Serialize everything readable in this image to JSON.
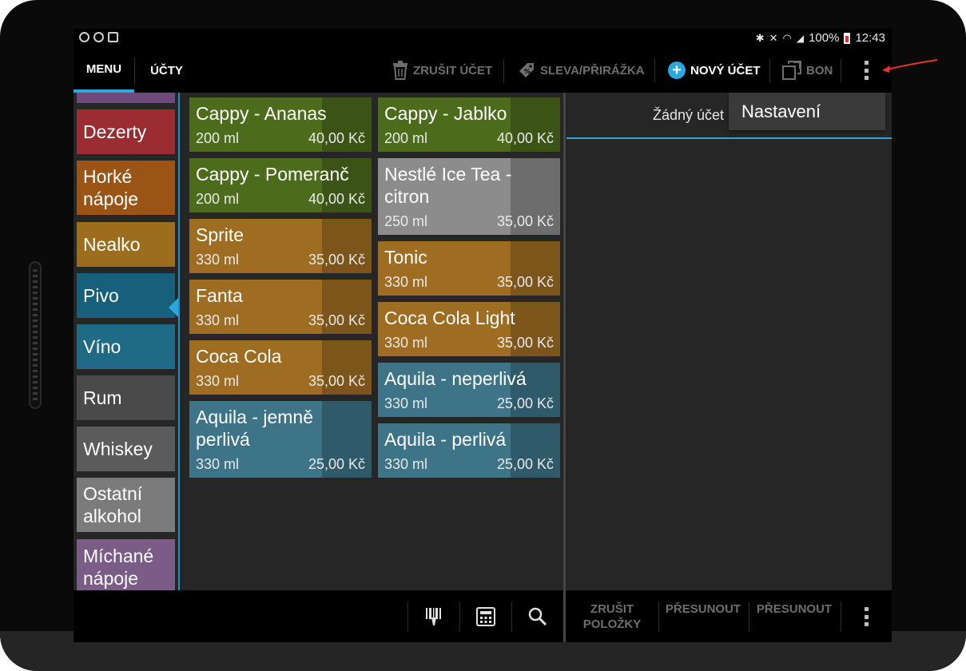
{
  "status_bar": {
    "battery": "100%",
    "time": "12:43"
  },
  "action_bar": {
    "tabs": [
      {
        "label": "MENU",
        "active": true
      },
      {
        "label": "ÚČTY",
        "active": false
      }
    ],
    "actions": [
      {
        "label": "ZRUŠIT ÚČET",
        "icon": "trash-icon",
        "enabled": false
      },
      {
        "label": "SLEVA/PŘIRÁŽKA",
        "icon": "tag-icon",
        "enabled": false
      },
      {
        "label": "NOVÝ ÚČET",
        "icon": "plus-circle-icon",
        "enabled": true
      },
      {
        "label": "BON",
        "icon": "bon-icon",
        "enabled": false
      }
    ],
    "overflow_icon": "overflow-menu-icon"
  },
  "categories": [
    {
      "label": "Dezerty",
      "color": "#9b2c31"
    },
    {
      "label": "Horké nápoje",
      "color": "#9a5516"
    },
    {
      "label": "Nealko",
      "color": "#9c6d1d",
      "selected": true
    },
    {
      "label": "Pivo",
      "color": "#17607c"
    },
    {
      "label": "Víno",
      "color": "#1f6b86"
    },
    {
      "label": "Rum",
      "color": "#4a4a4a"
    },
    {
      "label": "Whiskey",
      "color": "#5b5b5b"
    },
    {
      "label": "Ostatní alkohol",
      "color": "#7b7b7b"
    },
    {
      "label": "Míchané nápoje",
      "color": "#7a5c87"
    }
  ],
  "products": [
    {
      "name": "Cappy - Ananas",
      "volume": "200 ml",
      "price": "40,00 Kč",
      "color": "#4c6c1c"
    },
    {
      "name": "Cappy - Jablko",
      "volume": "200 ml",
      "price": "40,00 Kč",
      "color": "#4c6c1c"
    },
    {
      "name": "Cappy - Pomeranč",
      "volume": "200 ml",
      "price": "40,00 Kč",
      "color": "#4c6c1c"
    },
    {
      "name": "Nestlé Ice Tea - citron",
      "volume": "250 ml",
      "price": "35,00 Kč",
      "color": "#8c8c8c"
    },
    {
      "name": "Sprite",
      "volume": "330 ml",
      "price": "35,00 Kč",
      "color": "#9f6d22"
    },
    {
      "name": "Tonic",
      "volume": "330 ml",
      "price": "35,00 Kč",
      "color": "#9f6d22"
    },
    {
      "name": "Fanta",
      "volume": "330 ml",
      "price": "35,00 Kč",
      "color": "#9f6d22"
    },
    {
      "name": "Coca Cola Light",
      "volume": "330 ml",
      "price": "35,00 Kč",
      "color": "#9f6d22"
    },
    {
      "name": "Coca Cola",
      "volume": "330 ml",
      "price": "35,00 Kč",
      "color": "#9f6d22"
    },
    {
      "name": "Aquila - neperlivá",
      "volume": "330 ml",
      "price": "25,00 Kč",
      "color": "#3d7488"
    },
    {
      "name": "Aquila - jemně perlivá",
      "volume": "330 ml",
      "price": "25,00 Kč",
      "color": "#3d7488"
    },
    {
      "name": "Aquila - perlivá",
      "volume": "330 ml",
      "price": "25,00 Kč",
      "color": "#3d7488"
    }
  ],
  "account_panel": {
    "title": "Žádný účet"
  },
  "overflow_menu": {
    "item": "Nastavení"
  },
  "bottom_left": {
    "icons": [
      "barcode-icon",
      "calculator-icon",
      "search-icon"
    ]
  },
  "bottom_right": {
    "buttons": [
      {
        "label": "ZRUŠIT POLOŽKY"
      },
      {
        "label": "PŘESUNOUT"
      },
      {
        "label": "PŘESUNOUT"
      }
    ],
    "overflow_icon": "overflow-menu-icon"
  },
  "accent_color": "#29a8e0"
}
